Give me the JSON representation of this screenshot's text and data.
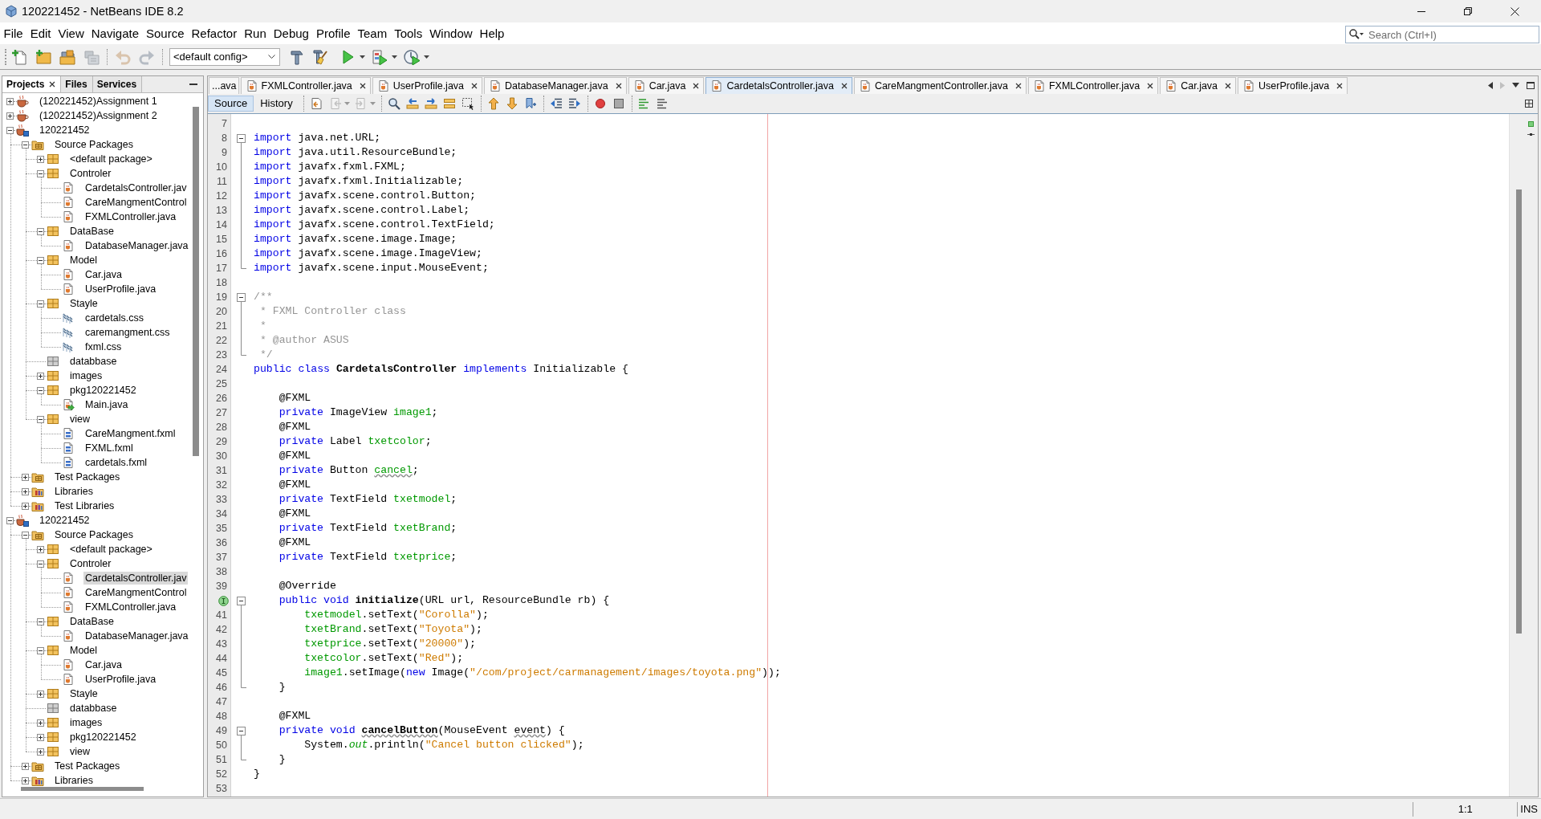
{
  "window": {
    "title": "120221452 - NetBeans IDE 8.2"
  },
  "menu": [
    "File",
    "Edit",
    "View",
    "Navigate",
    "Source",
    "Refactor",
    "Run",
    "Debug",
    "Profile",
    "Team",
    "Tools",
    "Window",
    "Help"
  ],
  "search": {
    "placeholder": "Search (Ctrl+I)"
  },
  "toolbar": [
    {
      "kind": "newfile",
      "disabled": false
    },
    {
      "kind": "newproject",
      "disabled": false
    },
    {
      "kind": "openproject",
      "disabled": false
    },
    {
      "kind": "closeproject",
      "disabled": true
    },
    {
      "kind": "undo",
      "disabled": true
    },
    {
      "kind": "redo",
      "disabled": true
    },
    {
      "kind": "config",
      "value": "<default config>"
    },
    {
      "kind": "build",
      "disabled": false
    },
    {
      "kind": "cleanbuild",
      "disabled": false
    },
    {
      "kind": "run",
      "disabled": false
    },
    {
      "kind": "debug",
      "disabled": false
    },
    {
      "kind": "profile",
      "disabled": false
    }
  ],
  "projects_panel": {
    "tabs": [
      {
        "label": "Projects",
        "selected": true,
        "closable": true
      },
      {
        "label": "Files",
        "selected": false,
        "closable": false
      },
      {
        "label": "Services",
        "selected": false,
        "closable": false
      }
    ],
    "tree": [
      {
        "label": "(120221452)Assignment 1",
        "kind": "project",
        "expanded": false,
        "selected": false
      },
      {
        "label": "(120221452)Assignment 2",
        "kind": "project",
        "expanded": false,
        "selected": false
      },
      {
        "label": "120221452",
        "kind": "fxproject",
        "expanded": true,
        "selected": false,
        "children": [
          {
            "label": "Source Packages",
            "kind": "sources",
            "expanded": true,
            "selected": false,
            "children": [
              {
                "label": "<default package>",
                "kind": "package",
                "expanded": false,
                "selected": false
              },
              {
                "label": "Controler",
                "kind": "package",
                "expanded": true,
                "selected": false,
                "children": [
                  {
                    "label": "CardetalsController.jav",
                    "kind": "java",
                    "selected": false
                  },
                  {
                    "label": "CareMangmentControl",
                    "kind": "java",
                    "selected": false
                  },
                  {
                    "label": "FXMLController.java",
                    "kind": "java",
                    "selected": false
                  }
                ]
              },
              {
                "label": "DataBase",
                "kind": "package",
                "expanded": true,
                "selected": false,
                "children": [
                  {
                    "label": "DatabaseManager.java",
                    "kind": "java",
                    "selected": false
                  }
                ]
              },
              {
                "label": "Model",
                "kind": "package",
                "expanded": true,
                "selected": false,
                "children": [
                  {
                    "label": "Car.java",
                    "kind": "java",
                    "selected": false
                  },
                  {
                    "label": "UserProfile.java",
                    "kind": "java",
                    "selected": false
                  }
                ]
              },
              {
                "label": "Stayle",
                "kind": "package",
                "expanded": true,
                "selected": false,
                "children": [
                  {
                    "label": "cardetals.css",
                    "kind": "css",
                    "selected": false
                  },
                  {
                    "label": "caremangment.css",
                    "kind": "css",
                    "selected": false
                  },
                  {
                    "label": "fxml.css",
                    "kind": "css",
                    "selected": false
                  }
                ]
              },
              {
                "label": "databbase",
                "kind": "emptypackage",
                "selected": false
              },
              {
                "label": "images",
                "kind": "package",
                "expanded": false,
                "selected": false
              },
              {
                "label": "pkg120221452",
                "kind": "package",
                "expanded": true,
                "selected": false,
                "children": [
                  {
                    "label": "Main.java",
                    "kind": "main",
                    "selected": false
                  }
                ]
              },
              {
                "label": "view",
                "kind": "package",
                "expanded": true,
                "selected": false,
                "children": [
                  {
                    "label": "CareMangment.fxml",
                    "kind": "fxml",
                    "selected": false
                  },
                  {
                    "label": "FXML.fxml",
                    "kind": "fxml",
                    "selected": false
                  },
                  {
                    "label": "cardetals.fxml",
                    "kind": "fxml",
                    "selected": false
                  }
                ]
              }
            ]
          },
          {
            "label": "Test Packages",
            "kind": "testsources",
            "expanded": false,
            "selected": false
          },
          {
            "label": "Libraries",
            "kind": "libraries",
            "expanded": false,
            "selected": false
          },
          {
            "label": "Test Libraries",
            "kind": "testlibraries",
            "expanded": false,
            "selected": false
          }
        ]
      },
      {
        "label": "120221452",
        "kind": "fxproject",
        "expanded": true,
        "selected": false,
        "children": [
          {
            "label": "Source Packages",
            "kind": "sources",
            "expanded": true,
            "selected": false,
            "children": [
              {
                "label": "<default package>",
                "kind": "package",
                "expanded": false,
                "selected": false
              },
              {
                "label": "Controler",
                "kind": "package",
                "expanded": true,
                "selected": false,
                "children": [
                  {
                    "label": "CardetalsController.jav",
                    "kind": "java",
                    "selected": true
                  },
                  {
                    "label": "CareMangmentControl",
                    "kind": "java",
                    "selected": false
                  },
                  {
                    "label": "FXMLController.java",
                    "kind": "java",
                    "selected": false
                  }
                ]
              },
              {
                "label": "DataBase",
                "kind": "package",
                "expanded": true,
                "selected": false,
                "children": [
                  {
                    "label": "DatabaseManager.java",
                    "kind": "java",
                    "selected": false
                  }
                ]
              },
              {
                "label": "Model",
                "kind": "package",
                "expanded": true,
                "selected": false,
                "children": [
                  {
                    "label": "Car.java",
                    "kind": "java",
                    "selected": false
                  },
                  {
                    "label": "UserProfile.java",
                    "kind": "java",
                    "selected": false
                  }
                ]
              },
              {
                "label": "Stayle",
                "kind": "package",
                "expanded": false,
                "selected": false
              },
              {
                "label": "databbase",
                "kind": "emptypackage",
                "selected": false
              },
              {
                "label": "images",
                "kind": "package",
                "expanded": false,
                "selected": false
              },
              {
                "label": "pkg120221452",
                "kind": "package",
                "expanded": false,
                "selected": false
              },
              {
                "label": "view",
                "kind": "package",
                "expanded": false,
                "selected": false
              }
            ]
          },
          {
            "label": "Test Packages",
            "kind": "testsources",
            "expanded": false,
            "selected": false
          },
          {
            "label": "Libraries",
            "kind": "libraries",
            "expanded": false,
            "selected": false
          }
        ]
      }
    ]
  },
  "editor": {
    "tabs": [
      {
        "label": "...ava",
        "kind": "clipped",
        "selected": false
      },
      {
        "label": "FXMLController.java",
        "kind": "file",
        "selected": false
      },
      {
        "label": "UserProfile.java",
        "kind": "file",
        "selected": false
      },
      {
        "label": "DatabaseManager.java",
        "kind": "file",
        "selected": false
      },
      {
        "label": "Car.java",
        "kind": "file",
        "selected": false
      },
      {
        "label": "CardetalsController.java",
        "kind": "file",
        "selected": true
      },
      {
        "label": "CareMangmentController.java",
        "kind": "file",
        "selected": false
      },
      {
        "label": "FXMLController.java",
        "kind": "file",
        "selected": false
      },
      {
        "label": "Car.java",
        "kind": "file",
        "selected": false
      },
      {
        "label": "UserProfile.java",
        "kind": "file",
        "selected": false
      }
    ],
    "tab_scroll": {
      "left_disabled": false,
      "right_disabled": true
    },
    "views": [
      {
        "label": "Source",
        "selected": true
      },
      {
        "label": "History",
        "selected": false
      }
    ],
    "tools": [
      {
        "kind": "lastedit",
        "disabled": false
      },
      {
        "kind": "back",
        "disabled": true
      },
      {
        "kind": "forward",
        "disabled": true
      },
      {
        "kind": "findselection",
        "disabled": false
      },
      {
        "kind": "findprevious",
        "disabled": false
      },
      {
        "kind": "findnext",
        "disabled": false
      },
      {
        "kind": "highlight",
        "disabled": false
      },
      {
        "kind": "rectselect",
        "disabled": false
      },
      {
        "kind": "previousbookmark",
        "disabled": false
      },
      {
        "kind": "nextbookmark",
        "disabled": false
      },
      {
        "kind": "togglebookmark",
        "disabled": false
      },
      {
        "kind": "shiftleft",
        "disabled": false
      },
      {
        "kind": "shiftright",
        "disabled": false
      },
      {
        "kind": "startmacro",
        "disabled": false
      },
      {
        "kind": "stopmacro",
        "disabled": false
      },
      {
        "kind": "comment",
        "disabled": false
      },
      {
        "kind": "uncomment",
        "disabled": false
      }
    ],
    "lines": [
      {
        "number": "7"
      },
      {
        "number": "8",
        "fold": {
          "kind": "start"
        },
        "tokens": [
          {
            "kind": "keyword",
            "text": "import"
          },
          {
            "kind": "plain",
            "text": " java.net.URL;"
          }
        ]
      },
      {
        "number": "9",
        "fold": {
          "kind": "line"
        },
        "tokens": [
          {
            "kind": "keyword",
            "text": "import"
          },
          {
            "kind": "plain",
            "text": " java.util.ResourceBundle;"
          }
        ]
      },
      {
        "number": "10",
        "fold": {
          "kind": "line"
        },
        "tokens": [
          {
            "kind": "keyword",
            "text": "import"
          },
          {
            "kind": "plain",
            "text": " javafx.fxml.FXML;"
          }
        ]
      },
      {
        "number": "11",
        "fold": {
          "kind": "line"
        },
        "tokens": [
          {
            "kind": "keyword",
            "text": "import"
          },
          {
            "kind": "plain",
            "text": " javafx.fxml.Initializable;"
          }
        ]
      },
      {
        "number": "12",
        "fold": {
          "kind": "line"
        },
        "tokens": [
          {
            "kind": "keyword",
            "text": "import"
          },
          {
            "kind": "plain",
            "text": " javafx.scene.control.Button;"
          }
        ]
      },
      {
        "number": "13",
        "fold": {
          "kind": "line"
        },
        "tokens": [
          {
            "kind": "keyword",
            "text": "import"
          },
          {
            "kind": "plain",
            "text": " javafx.scene.control.Label;"
          }
        ]
      },
      {
        "number": "14",
        "fold": {
          "kind": "line"
        },
        "tokens": [
          {
            "kind": "keyword",
            "text": "import"
          },
          {
            "kind": "plain",
            "text": " javafx.scene.control.TextField;"
          }
        ]
      },
      {
        "number": "15",
        "fold": {
          "kind": "line"
        },
        "tokens": [
          {
            "kind": "keyword",
            "text": "import"
          },
          {
            "kind": "plain",
            "text": " javafx.scene.image.Image;"
          }
        ]
      },
      {
        "number": "16",
        "fold": {
          "kind": "line"
        },
        "tokens": [
          {
            "kind": "keyword",
            "text": "import"
          },
          {
            "kind": "plain",
            "text": " javafx.scene.image.ImageView;"
          }
        ]
      },
      {
        "number": "17",
        "fold": {
          "kind": "end"
        },
        "tokens": [
          {
            "kind": "keyword",
            "text": "import"
          },
          {
            "kind": "plain",
            "text": " javafx.scene.input.MouseEvent;"
          }
        ]
      },
      {
        "number": "18"
      },
      {
        "number": "19",
        "fold": {
          "kind": "start"
        },
        "tokens": [
          {
            "kind": "comment",
            "text": "/**"
          }
        ]
      },
      {
        "number": "20",
        "fold": {
          "kind": "line"
        },
        "tokens": [
          {
            "kind": "comment",
            "text": " * FXML Controller class"
          }
        ]
      },
      {
        "number": "21",
        "fold": {
          "kind": "line"
        },
        "tokens": [
          {
            "kind": "comment",
            "text": " *"
          }
        ]
      },
      {
        "number": "22",
        "fold": {
          "kind": "line"
        },
        "tokens": [
          {
            "kind": "comment",
            "text": " * @author ASUS"
          }
        ]
      },
      {
        "number": "23",
        "fold": {
          "kind": "end"
        },
        "tokens": [
          {
            "kind": "comment",
            "text": " */"
          }
        ]
      },
      {
        "number": "24",
        "tokens": [
          {
            "kind": "keyword",
            "text": "public class "
          },
          {
            "kind": "declaration",
            "text": "CardetalsController"
          },
          {
            "kind": "keyword",
            "text": " implements "
          },
          {
            "kind": "plain",
            "text": "Initializable {"
          }
        ]
      },
      {
        "number": "25"
      },
      {
        "number": "26",
        "tokens": [
          {
            "kind": "plain",
            "text": "    @FXML"
          }
        ]
      },
      {
        "number": "27",
        "tokens": [
          {
            "kind": "keyword",
            "text": "    private "
          },
          {
            "kind": "plain",
            "text": "ImageView "
          },
          {
            "kind": "field",
            "text": "image1"
          },
          {
            "kind": "plain",
            "text": ";"
          }
        ]
      },
      {
        "number": "28",
        "tokens": [
          {
            "kind": "plain",
            "text": "    @FXML"
          }
        ]
      },
      {
        "number": "29",
        "tokens": [
          {
            "kind": "keyword",
            "text": "    private "
          },
          {
            "kind": "plain",
            "text": "Label "
          },
          {
            "kind": "field",
            "text": "txetcolor"
          },
          {
            "kind": "plain",
            "text": ";"
          }
        ]
      },
      {
        "number": "30",
        "tokens": [
          {
            "kind": "plain",
            "text": "    @FXML"
          }
        ]
      },
      {
        "number": "31",
        "tokens": [
          {
            "kind": "keyword",
            "text": "    private "
          },
          {
            "kind": "plain",
            "text": "Button "
          },
          {
            "kind": "unusedfield",
            "text": "cancel"
          },
          {
            "kind": "plain",
            "text": ";"
          }
        ]
      },
      {
        "number": "32",
        "tokens": [
          {
            "kind": "plain",
            "text": "    @FXML"
          }
        ]
      },
      {
        "number": "33",
        "tokens": [
          {
            "kind": "keyword",
            "text": "    private "
          },
          {
            "kind": "plain",
            "text": "TextField "
          },
          {
            "kind": "field",
            "text": "txetmodel"
          },
          {
            "kind": "plain",
            "text": ";"
          }
        ]
      },
      {
        "number": "34",
        "tokens": [
          {
            "kind": "plain",
            "text": "    @FXML"
          }
        ]
      },
      {
        "number": "35",
        "tokens": [
          {
            "kind": "keyword",
            "text": "    private "
          },
          {
            "kind": "plain",
            "text": "TextField "
          },
          {
            "kind": "field",
            "text": "txetBrand"
          },
          {
            "kind": "plain",
            "text": ";"
          }
        ]
      },
      {
        "number": "36",
        "tokens": [
          {
            "kind": "plain",
            "text": "    @FXML"
          }
        ]
      },
      {
        "number": "37",
        "tokens": [
          {
            "kind": "keyword",
            "text": "    private "
          },
          {
            "kind": "plain",
            "text": "TextField "
          },
          {
            "kind": "field",
            "text": "txetprice"
          },
          {
            "kind": "plain",
            "text": ";"
          }
        ]
      },
      {
        "number": "38"
      },
      {
        "number": "39",
        "tokens": [
          {
            "kind": "plain",
            "text": "    @Override"
          }
        ]
      },
      {
        "gutter": {
          "kind": "implements"
        },
        "fold": {
          "kind": "start"
        },
        "tokens": [
          {
            "kind": "keyword",
            "text": "    public void "
          },
          {
            "kind": "declaration",
            "text": "initialize"
          },
          {
            "kind": "plain",
            "text": "(URL url, ResourceBundle rb) {"
          }
        ]
      },
      {
        "number": "41",
        "fold": {
          "kind": "line"
        },
        "tokens": [
          {
            "kind": "field",
            "text": "        txetmodel"
          },
          {
            "kind": "plain",
            "text": ".setText("
          },
          {
            "kind": "string",
            "text": "\"Corolla\""
          },
          {
            "kind": "plain",
            "text": ");"
          }
        ]
      },
      {
        "number": "42",
        "fold": {
          "kind": "line"
        },
        "tokens": [
          {
            "kind": "field",
            "text": "        txetBrand"
          },
          {
            "kind": "plain",
            "text": ".setText("
          },
          {
            "kind": "string",
            "text": "\"Toyota\""
          },
          {
            "kind": "plain",
            "text": ");"
          }
        ]
      },
      {
        "number": "43",
        "fold": {
          "kind": "line"
        },
        "tokens": [
          {
            "kind": "field",
            "text": "        txetprice"
          },
          {
            "kind": "plain",
            "text": ".setText("
          },
          {
            "kind": "string",
            "text": "\"20000\""
          },
          {
            "kind": "plain",
            "text": ");"
          }
        ]
      },
      {
        "number": "44",
        "fold": {
          "kind": "line"
        },
        "tokens": [
          {
            "kind": "field",
            "text": "        txetcolor"
          },
          {
            "kind": "plain",
            "text": ".setText("
          },
          {
            "kind": "string",
            "text": "\"Red\""
          },
          {
            "kind": "plain",
            "text": ");"
          }
        ]
      },
      {
        "number": "45",
        "fold": {
          "kind": "line"
        },
        "tokens": [
          {
            "kind": "field",
            "text": "        image1"
          },
          {
            "kind": "plain",
            "text": ".setImage("
          },
          {
            "kind": "keyword",
            "text": "new "
          },
          {
            "kind": "plain",
            "text": "Image("
          },
          {
            "kind": "string",
            "text": "\"/com/project/carmanagement/images/toyota.png\""
          },
          {
            "kind": "plain",
            "text": "));"
          }
        ]
      },
      {
        "number": "46",
        "fold": {
          "kind": "end"
        },
        "tokens": [
          {
            "kind": "plain",
            "text": "    }"
          }
        ]
      },
      {
        "number": "47"
      },
      {
        "number": "48",
        "tokens": [
          {
            "kind": "plain",
            "text": "    @FXML"
          }
        ]
      },
      {
        "number": "49",
        "fold": {
          "kind": "start"
        },
        "tokens": [
          {
            "kind": "keyword",
            "text": "    private void "
          },
          {
            "kind": "unuseddeclaration",
            "text": "cancelButton"
          },
          {
            "kind": "plain",
            "text": "(MouseEvent "
          },
          {
            "kind": "unusedparameter",
            "text": "event"
          },
          {
            "kind": "plain",
            "text": ") {"
          }
        ]
      },
      {
        "number": "50",
        "fold": {
          "kind": "line"
        },
        "tokens": [
          {
            "kind": "plain",
            "text": "        System."
          },
          {
            "kind": "static",
            "text": "out"
          },
          {
            "kind": "plain",
            "text": ".println("
          },
          {
            "kind": "string",
            "text": "\"Cancel button clicked\""
          },
          {
            "kind": "plain",
            "text": ");"
          }
        ]
      },
      {
        "number": "51",
        "fold": {
          "kind": "end"
        },
        "tokens": [
          {
            "kind": "plain",
            "text": "    }"
          }
        ]
      },
      {
        "number": "52",
        "tokens": [
          {
            "kind": "plain",
            "text": "}"
          }
        ]
      },
      {
        "number": "53"
      }
    ]
  },
  "status_bar": {
    "position": "1:1",
    "mode": "INS"
  }
}
